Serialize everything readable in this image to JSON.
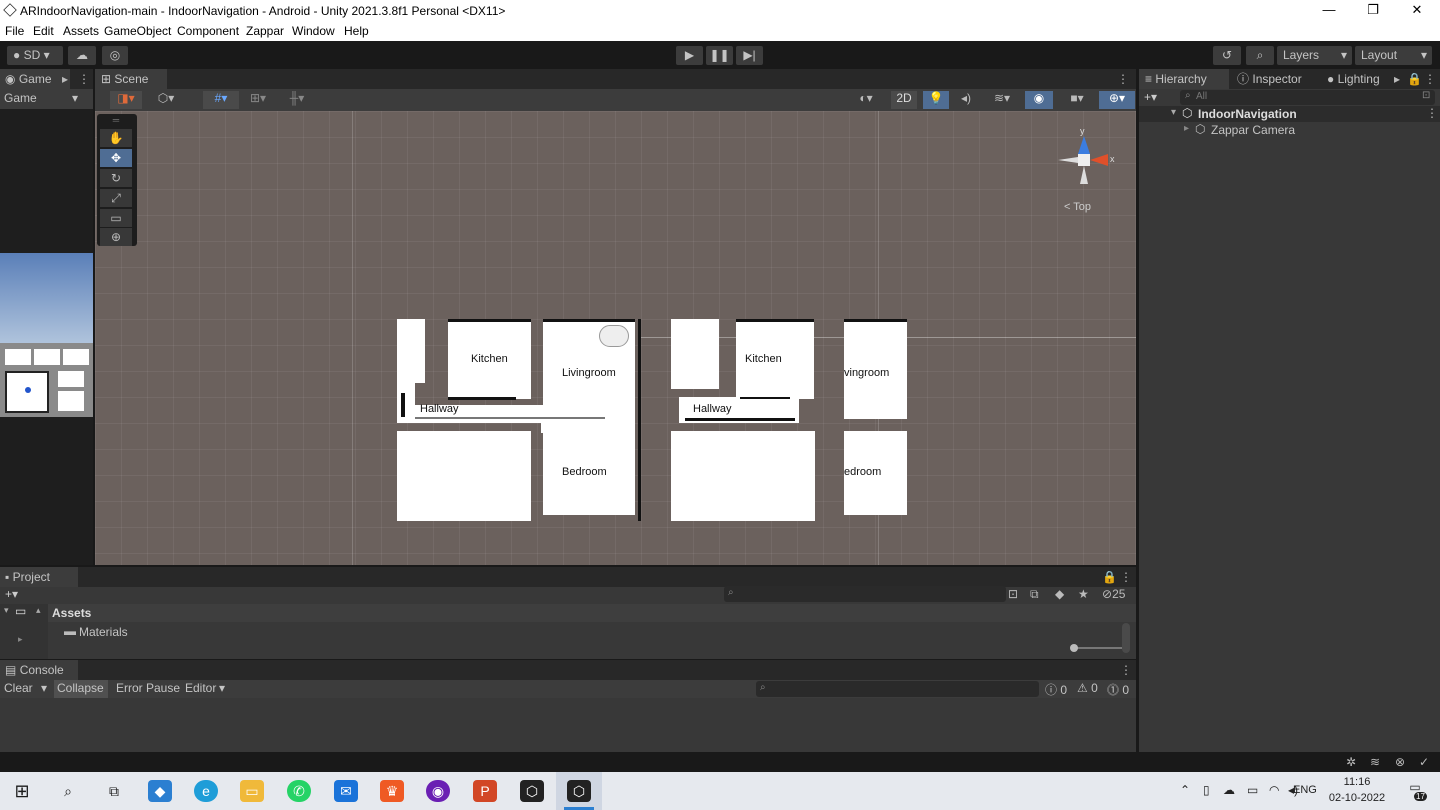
{
  "window": {
    "title": "ARIndoorNavigation-main - IndoorNavigation - Android - Unity 2021.3.8f1 Personal <DX11>",
    "minimize": "—",
    "maximize": "❐",
    "close": "✕"
  },
  "menu": [
    "File",
    "Edit",
    "Assets",
    "GameObject",
    "Component",
    "Zappar",
    "Window",
    "Help"
  ],
  "toolbar": {
    "account": "SD",
    "layers": "Layers",
    "layout": "Layout"
  },
  "game_panel": {
    "tab": "Game",
    "display": "Game"
  },
  "scene_panel": {
    "tab": "Scene",
    "mode_2d": "2D",
    "gizmo_view": "Top",
    "gizmo_x": "x",
    "gizmo_y": "y"
  },
  "floorplan": {
    "left": {
      "kitchen": "Kitchen",
      "livingroom": "Livingroom",
      "hallway": "Hallway",
      "bedroom": "Bedroom"
    },
    "right": {
      "kitchen": "Kitchen",
      "livingroom": "vingroom",
      "hallway": "Hallway",
      "bedroom": "edroom"
    }
  },
  "hierarchy": {
    "tabs": [
      "Hierarchy",
      "Inspector",
      "Lighting"
    ],
    "search_placeholder": "All",
    "root": "IndoorNavigation",
    "child": "Zappar Camera"
  },
  "project": {
    "tab": "Project",
    "hidden_count": "25",
    "folder_root": "Assets",
    "folder_child": "Materials"
  },
  "console": {
    "tab": "Console",
    "clear": "Clear",
    "collapse": "Collapse",
    "error_pause": "Error Pause",
    "editor": "Editor",
    "log_count": "0",
    "warn_count": "0",
    "error_count": "0"
  },
  "taskbar": {
    "language": "ENG",
    "time": "11:16",
    "date": "02-10-2022",
    "notifications": "17"
  }
}
